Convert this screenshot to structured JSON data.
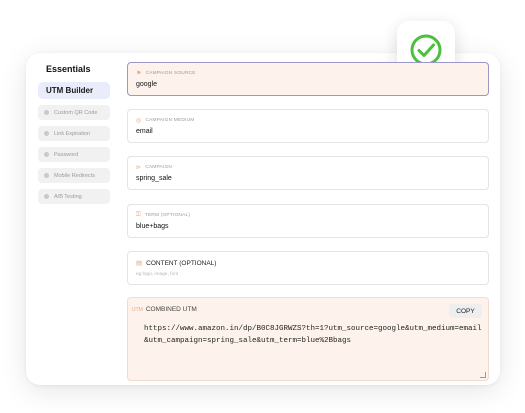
{
  "colors": {
    "accent": "#9a98c9",
    "active_field_bg": "#fdf3ec",
    "success": "#4cc03c"
  },
  "sidebar": {
    "heading": "Essentials",
    "active_item": "UTM Builder",
    "items": [
      "Custom QR Code",
      "Link Expiration",
      "Password",
      "Mobile Redirects",
      "A/B Testing"
    ]
  },
  "fields": {
    "source": {
      "icon": "flag-icon",
      "label": "CAMPAIGN SOURCE",
      "value": "google"
    },
    "medium": {
      "icon": "sliders-icon",
      "label": "CAMPAIGN MEDIUM",
      "value": "email"
    },
    "campaign": {
      "icon": "tag-icon",
      "label": "CAMPAIGN",
      "value": "spring_sale"
    },
    "term": {
      "icon": "key-icon",
      "label": "TERM (OPTIONAL)",
      "value": "blue+bags"
    },
    "content": {
      "icon": "document-icon",
      "label": "CONTENT (OPTIONAL)",
      "placeholder": "eg:logo, image, font"
    }
  },
  "combined": {
    "icon": "utm-icon",
    "label": "COMBINED UTM",
    "copy_label": "COPY",
    "url": "https://www.amazon.in/dp/B0C8JGRWZS?th=1?utm_source=google&utm_medium=email&utm_campaign=spring_sale&utm_term=blue%2Bbags"
  }
}
